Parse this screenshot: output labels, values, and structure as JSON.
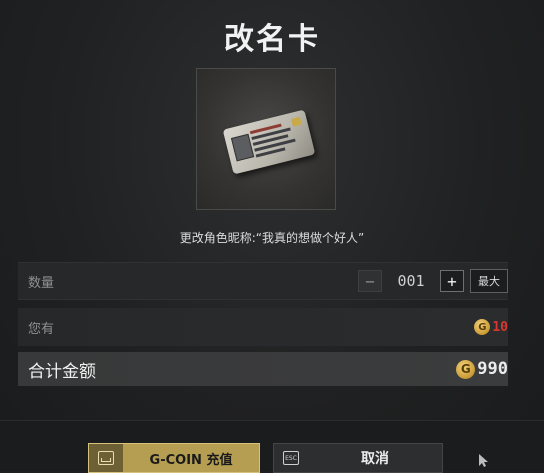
{
  "dialog": {
    "title": "改名卡",
    "description": "更改角色昵称:“我真的想做个好人”"
  },
  "quantity": {
    "label": "数量",
    "minus_symbol": "−",
    "value": "001",
    "plus_symbol": "+",
    "max_label": "最大"
  },
  "balance": {
    "label": "您有",
    "coin_symbol": "G",
    "value": "10",
    "value_color": "#d8372f"
  },
  "total": {
    "label": "合计金额",
    "coin_symbol": "G",
    "value": "990"
  },
  "buttons": {
    "recharge_label": "G-COIN 充值",
    "recharge_color": "#b59e52",
    "cancel_label": "取消",
    "cancel_key": "ESC"
  }
}
